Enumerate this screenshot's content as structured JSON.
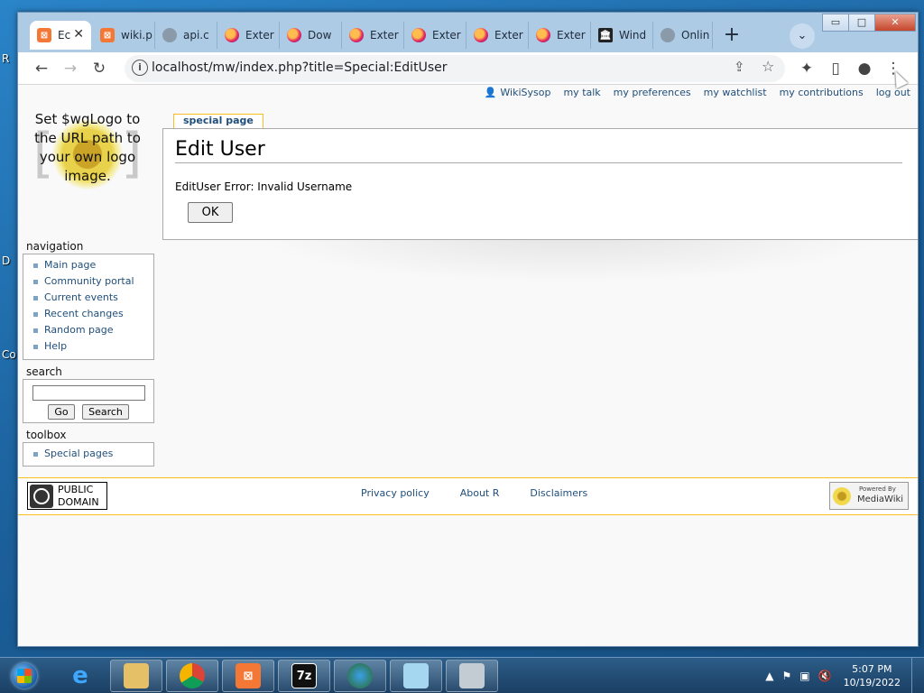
{
  "desktop": {
    "labels": [
      "R",
      "D",
      "Co"
    ]
  },
  "browser": {
    "tabs": [
      {
        "title": "Ec",
        "icon": "xampp-icon",
        "active": true
      },
      {
        "title": "wiki.p",
        "icon": "xampp-icon"
      },
      {
        "title": "api.c",
        "icon": "globe-icon"
      },
      {
        "title": "Exter",
        "icon": "firefox-icon"
      },
      {
        "title": "Dow",
        "icon": "firefox-icon"
      },
      {
        "title": "Exter",
        "icon": "firefox-icon"
      },
      {
        "title": "Exter",
        "icon": "firefox-icon"
      },
      {
        "title": "Exter",
        "icon": "firefox-icon"
      },
      {
        "title": "Exter",
        "icon": "firefox-icon"
      },
      {
        "title": "Wind",
        "icon": "museum-icon"
      },
      {
        "title": "Onlin",
        "icon": "globe-icon"
      }
    ],
    "new_tab": "+",
    "window_controls": {
      "minimize": "▭",
      "maximize": "□",
      "close": "✕"
    },
    "url": "localhost/mw/index.php?title=Special:EditUser",
    "toolbar_icons": [
      "back-icon",
      "forward-icon",
      "reload-icon",
      "share-icon",
      "star-icon",
      "extensions-icon",
      "sidepanel-icon",
      "profile-icon",
      "menu-icon"
    ]
  },
  "wiki": {
    "personal": {
      "user": "WikiSysop",
      "links": [
        "my talk",
        "my preferences",
        "my watchlist",
        "my contributions",
        "log out"
      ]
    },
    "logo_text": "Set $wgLogo to the URL path to your own logo image.",
    "navigation": {
      "title": "navigation",
      "items": [
        "Main page",
        "Community portal",
        "Current events",
        "Recent changes",
        "Random page",
        "Help"
      ]
    },
    "search": {
      "title": "search",
      "value": "",
      "go_label": "Go",
      "search_label": "Search"
    },
    "toolbox": {
      "title": "toolbox",
      "items": [
        "Special pages"
      ]
    },
    "content_tab": "special page",
    "heading": "Edit User",
    "error": "EditUser Error: Invalid Username",
    "ok_label": "OK",
    "footer": {
      "pd_line1": "PUBLIC",
      "pd_line2": "DOMAIN",
      "links": [
        "Privacy policy",
        "About R",
        "Disclaimers"
      ],
      "mw_line1": "Powered By",
      "mw_line2": "MediaWiki"
    }
  },
  "taskbar": {
    "apps": [
      "ie-icon",
      "explorer-icon",
      "chrome-icon",
      "xampp-icon",
      "7zip-icon",
      "network-icon",
      "notepad-icon",
      "recycle-icon"
    ],
    "time": "5:07 PM",
    "date": "10/19/2022"
  },
  "colors": {
    "link": "#1f4e7a",
    "tab_accent": "#fabd23",
    "tabstrip": "#aecbe6"
  }
}
